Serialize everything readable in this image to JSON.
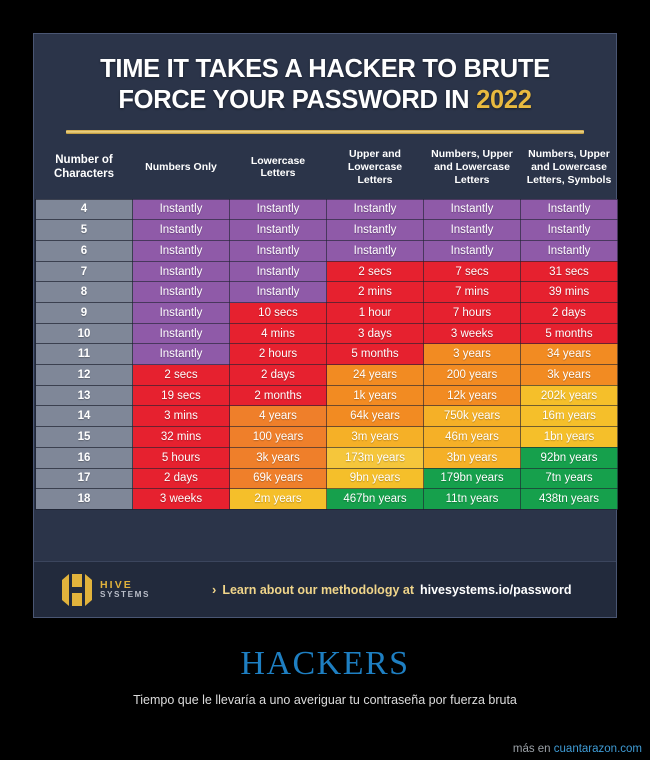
{
  "poster": {
    "title_line1": "TIME IT TAKES A HACKER TO BRUTE",
    "title_line2_pre": "FORCE YOUR PASSWORD IN ",
    "title_year": "2022",
    "caption_title": "HACKERS",
    "caption_sub": "Tiempo que le llevaría a uno averiguar tu contraseña por fuerza bruta",
    "watermark_prefix": "más en ",
    "watermark_site": "cuantarazon.com"
  },
  "footer": {
    "logo_line1": "HIVE",
    "logo_line2": "SYSTEMS",
    "chevron": "›",
    "methodology_text": "Learn about our methodology at ",
    "methodology_url": "hivesystems.io/password"
  },
  "colors": {
    "panel_bg": "#2b3449",
    "footer_bg": "#222a3c",
    "gold": "#e8b93f",
    "numcol": "#7f8798",
    "purple": "#8f5aa8",
    "red": "#e6212f",
    "orange": "#f08c22",
    "yellow": "#f5bf2a",
    "green": "#16a04c",
    "caption_blue": "#1e7fc2"
  },
  "chart_data": {
    "type": "table",
    "title": "TIME IT TAKES A HACKER TO BRUTE FORCE YOUR PASSWORD IN 2022",
    "columns": [
      "Number of Characters",
      "Numbers Only",
      "Lowercase Letters",
      "Upper and Lowercase Letters",
      "Numbers, Upper and Lowercase Letters",
      "Numbers, Upper and Lowercase Letters, Symbols"
    ],
    "column_lines": [
      [
        "Number of",
        "Characters"
      ],
      [
        "Numbers Only"
      ],
      [
        "Lowercase",
        "Letters"
      ],
      [
        "Upper and",
        "Lowercase",
        "Letters"
      ],
      [
        "Numbers, Upper",
        "and Lowercase",
        "Letters"
      ],
      [
        "Numbers, Upper",
        "and Lowercase",
        "Letters, Symbols"
      ]
    ],
    "rows": [
      {
        "chars": "4",
        "cells": [
          {
            "v": "Instantly",
            "c": "#8f5aa8"
          },
          {
            "v": "Instantly",
            "c": "#8f5aa8"
          },
          {
            "v": "Instantly",
            "c": "#8f5aa8"
          },
          {
            "v": "Instantly",
            "c": "#8f5aa8"
          },
          {
            "v": "Instantly",
            "c": "#8f5aa8"
          }
        ]
      },
      {
        "chars": "5",
        "cells": [
          {
            "v": "Instantly",
            "c": "#8f5aa8"
          },
          {
            "v": "Instantly",
            "c": "#8f5aa8"
          },
          {
            "v": "Instantly",
            "c": "#8f5aa8"
          },
          {
            "v": "Instantly",
            "c": "#8f5aa8"
          },
          {
            "v": "Instantly",
            "c": "#8f5aa8"
          }
        ]
      },
      {
        "chars": "6",
        "cells": [
          {
            "v": "Instantly",
            "c": "#8f5aa8"
          },
          {
            "v": "Instantly",
            "c": "#8f5aa8"
          },
          {
            "v": "Instantly",
            "c": "#8f5aa8"
          },
          {
            "v": "Instantly",
            "c": "#8f5aa8"
          },
          {
            "v": "Instantly",
            "c": "#8f5aa8"
          }
        ]
      },
      {
        "chars": "7",
        "cells": [
          {
            "v": "Instantly",
            "c": "#8f5aa8"
          },
          {
            "v": "Instantly",
            "c": "#8f5aa8"
          },
          {
            "v": "2 secs",
            "c": "#e6212f"
          },
          {
            "v": "7 secs",
            "c": "#e6212f"
          },
          {
            "v": "31 secs",
            "c": "#e6212f"
          }
        ]
      },
      {
        "chars": "8",
        "cells": [
          {
            "v": "Instantly",
            "c": "#8f5aa8"
          },
          {
            "v": "Instantly",
            "c": "#8f5aa8"
          },
          {
            "v": "2 mins",
            "c": "#e6212f"
          },
          {
            "v": "7 mins",
            "c": "#e6212f"
          },
          {
            "v": "39 mins",
            "c": "#e6212f"
          }
        ]
      },
      {
        "chars": "9",
        "cells": [
          {
            "v": "Instantly",
            "c": "#8f5aa8"
          },
          {
            "v": "10 secs",
            "c": "#e6212f"
          },
          {
            "v": "1 hour",
            "c": "#e6212f"
          },
          {
            "v": "7 hours",
            "c": "#e6212f"
          },
          {
            "v": "2 days",
            "c": "#e6212f"
          }
        ]
      },
      {
        "chars": "10",
        "cells": [
          {
            "v": "Instantly",
            "c": "#8f5aa8"
          },
          {
            "v": "4 mins",
            "c": "#e6212f"
          },
          {
            "v": "3 days",
            "c": "#e6212f"
          },
          {
            "v": "3 weeks",
            "c": "#e6212f"
          },
          {
            "v": "5 months",
            "c": "#e6212f"
          }
        ]
      },
      {
        "chars": "11",
        "cells": [
          {
            "v": "Instantly",
            "c": "#8f5aa8"
          },
          {
            "v": "2 hours",
            "c": "#e6212f"
          },
          {
            "v": "5 months",
            "c": "#e6212f"
          },
          {
            "v": "3 years",
            "c": "#f28b22"
          },
          {
            "v": "34 years",
            "c": "#f28b22"
          }
        ]
      },
      {
        "chars": "12",
        "cells": [
          {
            "v": "2 secs",
            "c": "#e6212f"
          },
          {
            "v": "2 days",
            "c": "#e6212f"
          },
          {
            "v": "24 years",
            "c": "#f28b22"
          },
          {
            "v": "200 years",
            "c": "#f28b22"
          },
          {
            "v": "3k years",
            "c": "#f28b22"
          }
        ]
      },
      {
        "chars": "13",
        "cells": [
          {
            "v": "19 secs",
            "c": "#e6212f"
          },
          {
            "v": "2 months",
            "c": "#e6212f"
          },
          {
            "v": "1k years",
            "c": "#f28b22"
          },
          {
            "v": "12k years",
            "c": "#f28b22"
          },
          {
            "v": "202k years",
            "c": "#f5bf2a"
          }
        ]
      },
      {
        "chars": "14",
        "cells": [
          {
            "v": "3 mins",
            "c": "#e6212f"
          },
          {
            "v": "4 years",
            "c": "#ef7f2a"
          },
          {
            "v": "64k years",
            "c": "#f28b22"
          },
          {
            "v": "750k years",
            "c": "#f5b027"
          },
          {
            "v": "16m years",
            "c": "#f5bf2a"
          }
        ]
      },
      {
        "chars": "15",
        "cells": [
          {
            "v": "32 mins",
            "c": "#e6212f"
          },
          {
            "v": "100 years",
            "c": "#ef7f2a"
          },
          {
            "v": "3m years",
            "c": "#f5b027"
          },
          {
            "v": "46m years",
            "c": "#f5b027"
          },
          {
            "v": "1bn years",
            "c": "#f5bf2a"
          }
        ]
      },
      {
        "chars": "16",
        "cells": [
          {
            "v": "5 hours",
            "c": "#e6212f"
          },
          {
            "v": "3k years",
            "c": "#ef7f2a"
          },
          {
            "v": "173m years",
            "c": "#f5c63b"
          },
          {
            "v": "3bn years",
            "c": "#f5b027"
          },
          {
            "v": "92bn years",
            "c": "#16a04c"
          }
        ]
      },
      {
        "chars": "17",
        "cells": [
          {
            "v": "2 days",
            "c": "#e6212f"
          },
          {
            "v": "69k years",
            "c": "#ef7f2a"
          },
          {
            "v": "9bn years",
            "c": "#f5bf2a"
          },
          {
            "v": "179bn years",
            "c": "#16a04c"
          },
          {
            "v": "7tn years",
            "c": "#16a04c"
          }
        ]
      },
      {
        "chars": "18",
        "cells": [
          {
            "v": "3 weeks",
            "c": "#e6212f"
          },
          {
            "v": "2m years",
            "c": "#f5bf2a"
          },
          {
            "v": "467bn years",
            "c": "#16a04c"
          },
          {
            "v": "11tn years",
            "c": "#16a04c"
          },
          {
            "v": "438tn years",
            "c": "#16a04c"
          }
        ]
      }
    ]
  }
}
